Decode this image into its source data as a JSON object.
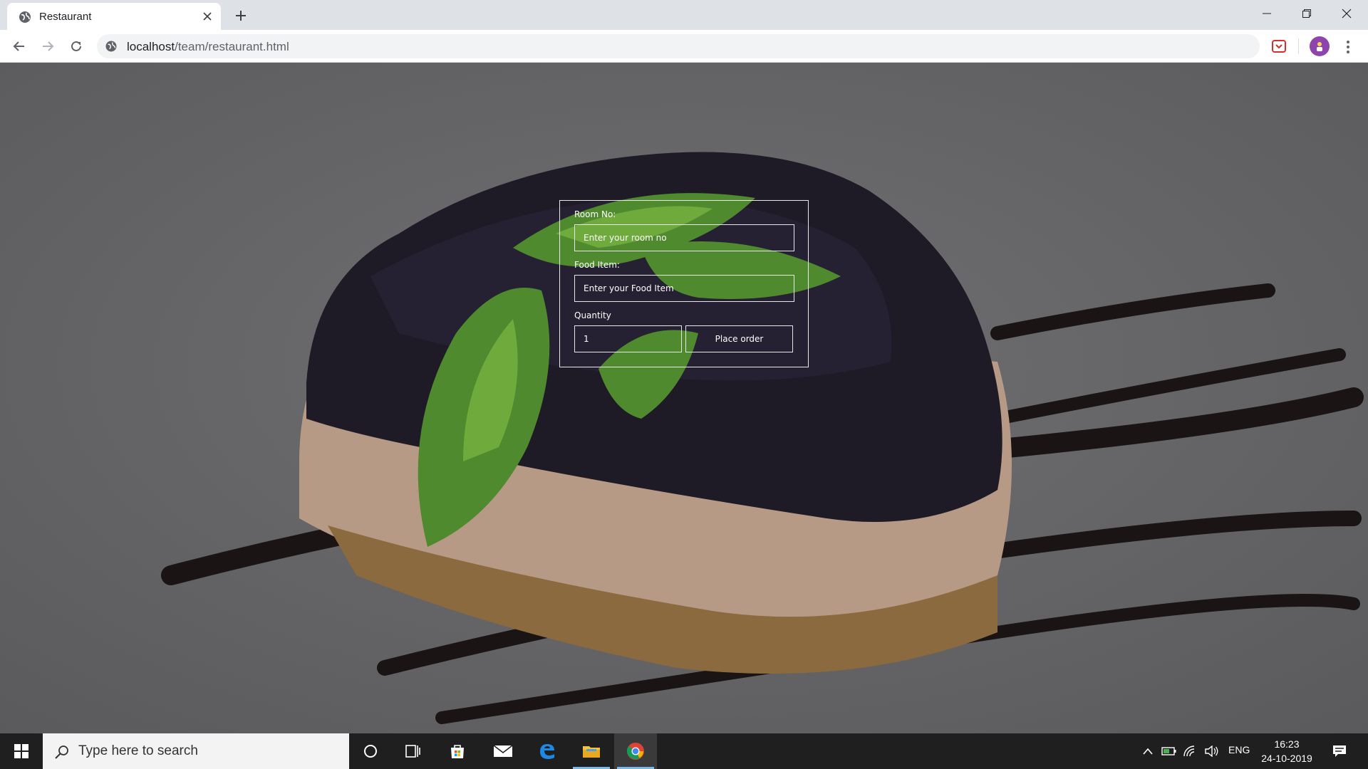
{
  "browser": {
    "tab_title": "Restaurant",
    "url_host": "localhost",
    "url_path": "/team/restaurant.html"
  },
  "form": {
    "room_label": "Room No:",
    "room_placeholder": "Enter your room no",
    "food_label": "Food Item:",
    "food_placeholder": "Enter your Food Item",
    "quantity_label": "Quantity",
    "quantity_value": "1",
    "submit_label": "Place order"
  },
  "taskbar": {
    "search_placeholder": "Type here to search",
    "language": "ENG",
    "time": "16:23",
    "date": "24-10-2019"
  },
  "colors": {
    "form_border": "#e8e8e8",
    "taskbar_bg": "#1f1f1f",
    "active_indicator": "#76b9ed",
    "avatar": "#8e44ad"
  },
  "icons": [
    "globe-icon",
    "close-icon",
    "plus-icon",
    "minimize-icon",
    "maximize-icon",
    "back-icon",
    "forward-icon",
    "reload-icon",
    "pocket-icon",
    "profile-icon",
    "menu-icon",
    "windows-icon",
    "search-icon",
    "cortana-icon",
    "task-view-icon",
    "store-icon",
    "mail-icon",
    "edge-icon",
    "file-explorer-icon",
    "chrome-icon",
    "chevron-up-icon",
    "battery-icon",
    "wifi-icon",
    "volume-icon",
    "notification-icon"
  ]
}
